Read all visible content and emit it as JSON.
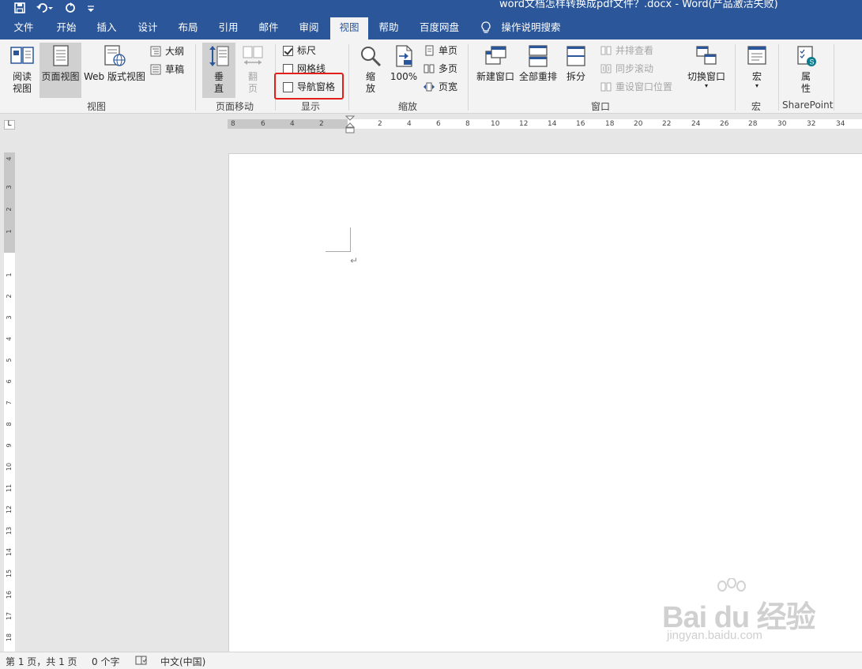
{
  "title_bar": {
    "title": "word文档怎样转换成pdf文件？.docx  -  Word(产品激活失败)",
    "qat": {
      "save": "💾",
      "undo": "↶▾",
      "redo": "↻",
      "customize": "▿"
    }
  },
  "tabs": [
    {
      "label": "文件"
    },
    {
      "label": "开始"
    },
    {
      "label": "插入"
    },
    {
      "label": "设计"
    },
    {
      "label": "布局"
    },
    {
      "label": "引用"
    },
    {
      "label": "邮件"
    },
    {
      "label": "审阅"
    },
    {
      "label": "视图",
      "active": true
    },
    {
      "label": "帮助"
    },
    {
      "label": "百度网盘"
    },
    {
      "label": "操作说明搜索"
    }
  ],
  "ribbon": {
    "views": {
      "read_mode": "阅读\n视图",
      "print_layout": "页面视图",
      "web_layout": "Web 版式视图",
      "outline": "大纲",
      "draft": "草稿",
      "group_label": "视图"
    },
    "page_movement": {
      "vertical": "垂\n直",
      "side_to_side": "翻\n页",
      "group_label": "页面移动"
    },
    "show": {
      "ruler": {
        "label": "标尺",
        "checked": true
      },
      "gridlines": {
        "label": "网格线",
        "checked": false
      },
      "navigation_pane": {
        "label": "导航窗格",
        "checked": false
      },
      "group_label": "显示"
    },
    "zoom": {
      "zoom": "缩\n放",
      "hundred": "100%",
      "one_page": "单页",
      "multiple_pages": "多页",
      "page_width": "页宽",
      "group_label": "缩放"
    },
    "window": {
      "new_window": "新建窗口",
      "arrange_all": "全部重排",
      "split": "拆分",
      "side_by_side": "并排查看",
      "sync_scroll": "同步滚动",
      "reset_position": "重设窗口位置",
      "switch_windows": "切换窗口",
      "group_label": "窗口"
    },
    "macros": {
      "macros": "宏",
      "group_label": "宏"
    },
    "sharepoint": {
      "properties": "属\n性",
      "group_label": "SharePoint"
    }
  },
  "ruler": {
    "horizontal": [
      "8",
      "6",
      "4",
      "2",
      "2",
      "4",
      "6",
      "8",
      "10",
      "12",
      "14",
      "16",
      "18",
      "20",
      "22",
      "24",
      "26",
      "28",
      "30",
      "32",
      "34"
    ],
    "vertical": [
      "4",
      "3",
      "2",
      "1",
      "1",
      "2",
      "3",
      "4",
      "5",
      "6",
      "7",
      "8",
      "9",
      "10",
      "11",
      "12",
      "13",
      "14",
      "15",
      "16",
      "17",
      "18"
    ],
    "tab_selector": "L"
  },
  "document": {
    "paragraph_mark": "↵"
  },
  "watermark": {
    "brand": "Bai du 经验",
    "url": "jingyan.baidu.com"
  },
  "status_bar": {
    "page": "第 1 页，共 1 页",
    "words": "0 个字",
    "language": "中文(中国)"
  }
}
